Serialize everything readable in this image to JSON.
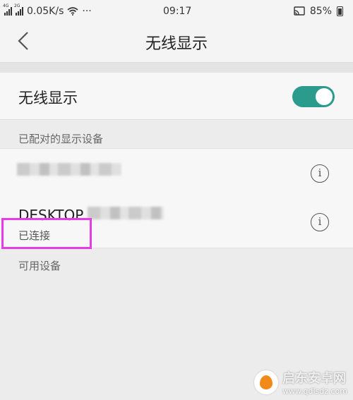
{
  "status_bar": {
    "network_speed": "0.05K/s",
    "dots": "···",
    "time": "09:17",
    "battery": "85%",
    "sig1_label": "4G",
    "sig2_label": "2G"
  },
  "header": {
    "title": "无线显示"
  },
  "wireless_display": {
    "label": "无线显示",
    "enabled": true
  },
  "paired_section": {
    "title": "已配对的显示设备",
    "devices": [
      {
        "name": "",
        "status": ""
      },
      {
        "name": "DESKTOP",
        "status": "已连接"
      }
    ]
  },
  "available_section": {
    "title": "可用设备"
  },
  "watermark": {
    "name": "启东安卓网",
    "url": "www.qdlsdz.com"
  },
  "colors": {
    "accent": "#2a9b8c",
    "highlight": "#e63ce6"
  }
}
